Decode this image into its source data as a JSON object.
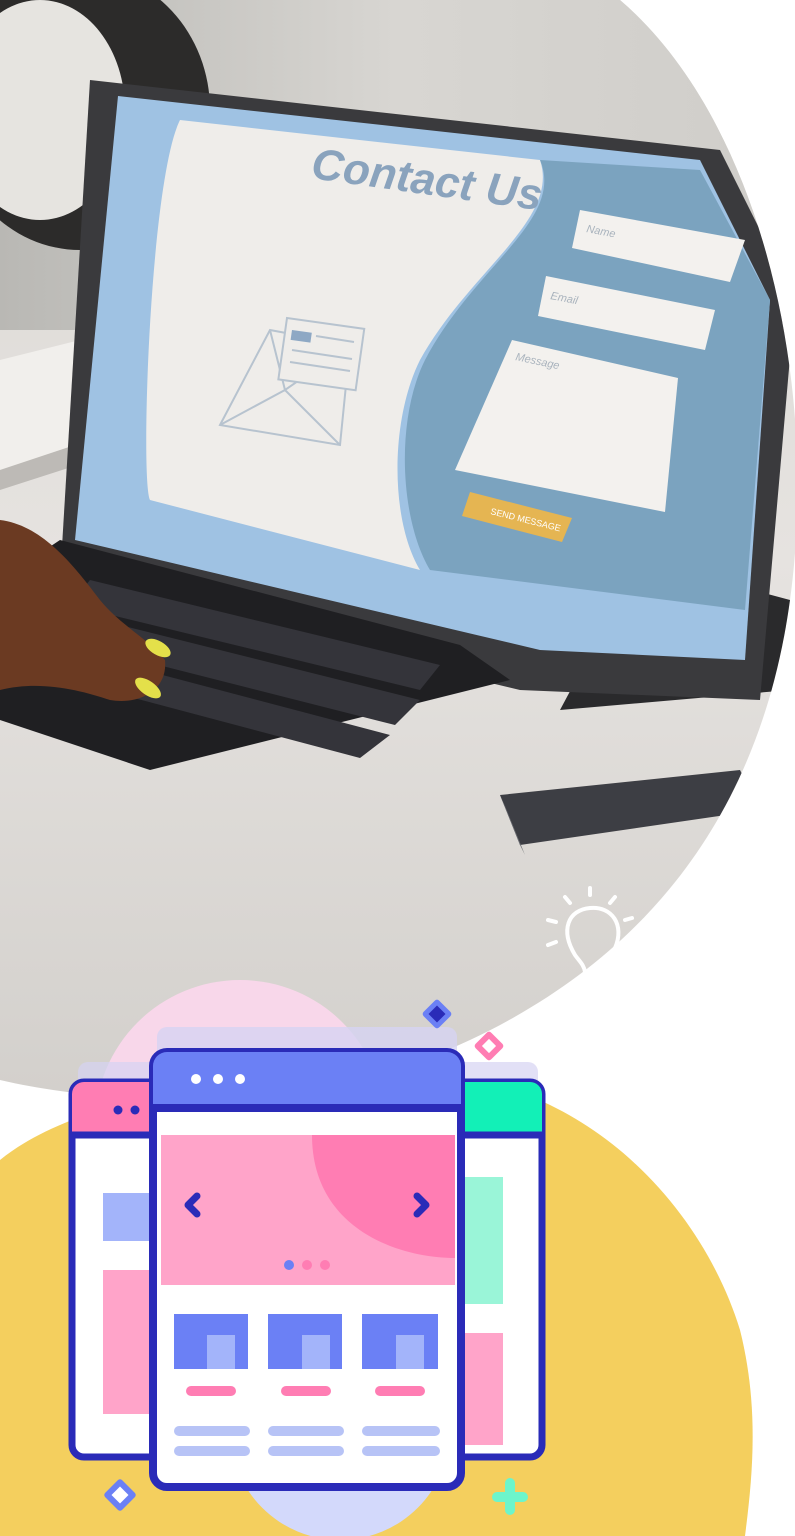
{
  "photo": {
    "screen_heading": "Contact Us",
    "form": {
      "name_placeholder": "Name",
      "email_placeholder": "Email",
      "message_placeholder": "Message",
      "send_button_label": "SEND MESSAGE"
    }
  },
  "icons": {
    "lightbulb": "lightbulb-icon",
    "browser_windows": "website-layout-illustration"
  },
  "colors": {
    "yellow_blob": "#f4cf5e",
    "pink_circle": "#f8d7ea",
    "window_outline": "#2a2bb8",
    "window_header_blue": "#6b80f5",
    "window_header_pink": "#ff7db3",
    "window_header_green": "#12f0b7",
    "hero_pink": "#ffa4c9",
    "hero_dark_pink": "#ff7db3",
    "tablet_screen": "#9fc2e3",
    "form_panel": "#7ba3bf",
    "send_button": "#e5b552"
  }
}
